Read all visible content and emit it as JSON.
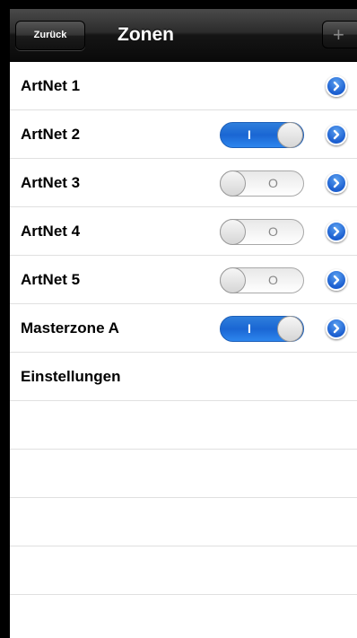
{
  "navbar": {
    "back_label": "Zurück",
    "title": "Zonen",
    "add_label": "+"
  },
  "rows": [
    {
      "label": "ArtNet 1",
      "toggle": null
    },
    {
      "label": "ArtNet 2",
      "toggle": "on"
    },
    {
      "label": "ArtNet 3",
      "toggle": "off"
    },
    {
      "label": "ArtNet 4",
      "toggle": "off"
    },
    {
      "label": "ArtNet 5",
      "toggle": "off"
    },
    {
      "label": "Masterzone A",
      "toggle": "on"
    },
    {
      "label": "Einstellungen",
      "toggle": null
    }
  ],
  "toggle_marks": {
    "on": "I",
    "off": "O"
  },
  "icons": {
    "disclosure": "chevron-right-circle-icon",
    "add": "plus-icon"
  },
  "colors": {
    "accent": "#1a66d3",
    "navbar": "#1c1c1c"
  }
}
